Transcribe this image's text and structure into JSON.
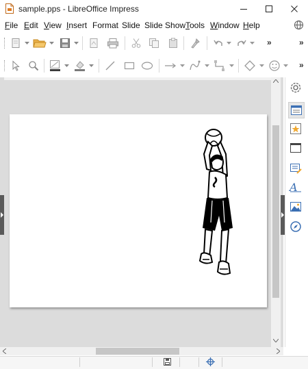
{
  "window": {
    "title": "sample.pps - LibreOffice Impress",
    "app_icon": "impress-document-icon",
    "controls": [
      "minimize-icon",
      "maximize-icon",
      "close-icon"
    ]
  },
  "menubar": {
    "items": [
      {
        "label": "File",
        "accel": "F",
        "rest": "ile"
      },
      {
        "label": "Edit",
        "accel": "E",
        "rest": "dit"
      },
      {
        "label": "View",
        "accel": "V",
        "rest": "iew"
      },
      {
        "label": "Insert",
        "accel": "I",
        "rest": "nsert"
      },
      {
        "label": "Format",
        "accel": "",
        "rest": "Format"
      },
      {
        "label": "Slide",
        "accel": "",
        "rest": "Slide"
      },
      {
        "label": "Slide Show",
        "accel": "",
        "rest": "Slide Show"
      },
      {
        "label": "Tools",
        "accel": "T",
        "rest": "ools"
      },
      {
        "label": "Window",
        "accel": "W",
        "rest": "indow"
      },
      {
        "label": "Help",
        "accel": "H",
        "rest": "elp"
      }
    ],
    "globe_icon": "language-globe-icon"
  },
  "toolbar_standard": {
    "icons": [
      "new-icon",
      "open-folder-icon",
      "save-icon",
      "export-pdf-icon",
      "print-icon",
      "cut-icon",
      "copy-icon",
      "paste-icon",
      "clone-formatting-icon",
      "undo-icon",
      "redo-icon"
    ],
    "more": "»"
  },
  "toolbar_drawing": {
    "icons": [
      "select-icon",
      "zoom-icon",
      "line-color-icon",
      "fill-color-icon",
      "line-icon",
      "rectangle-icon",
      "ellipse-icon",
      "lines-arrows-icon",
      "curves-icon",
      "connectors-icon",
      "basic-shapes-icon",
      "symbol-shapes-icon"
    ],
    "more": "»"
  },
  "slide": {
    "content": "basketball-player-clipart"
  },
  "sidebar": {
    "icons": [
      "settings-gear-icon",
      "properties-icon",
      "slide-transition-icon",
      "master-slides-icon",
      "animation-icon",
      "styles-icon",
      "gallery-icon",
      "navigator-icon"
    ]
  },
  "statusbar": {
    "icons": [
      "document-save-status-icon",
      "selection-mode-icon"
    ]
  }
}
